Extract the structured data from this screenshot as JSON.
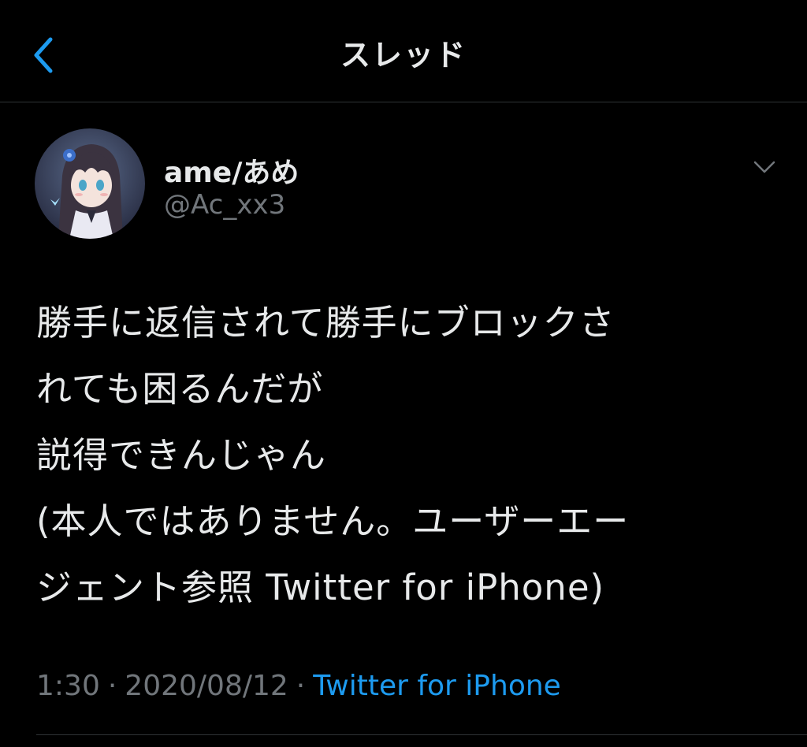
{
  "header": {
    "title": "スレッド",
    "back_icon": "chevron-left-icon"
  },
  "tweet": {
    "author": {
      "name": "ame/あめ",
      "handle": "@Ac_xx3",
      "avatar_icon": "avatar-image"
    },
    "more_icon": "chevron-down-icon",
    "text_lines": [
      "勝手に返信されて勝手にブロックさ",
      "れても困るんだが",
      "説得できんじゃん",
      "(本人ではありません。ユーザーエー",
      "ジェント参照 Twitter for iPhone)"
    ],
    "time": "1:30",
    "separator": "·",
    "date": "2020/08/12",
    "source": "Twitter for iPhone"
  },
  "colors": {
    "background": "#000000",
    "text": "#e7e9ea",
    "secondary": "#71767b",
    "accent": "#1d9bf0",
    "divider": "#2f3336"
  }
}
